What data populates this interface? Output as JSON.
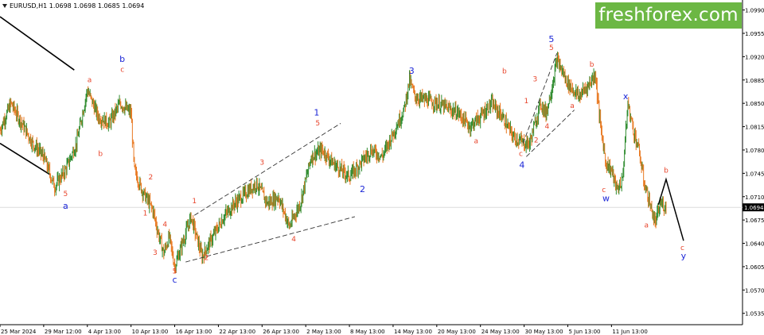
{
  "header": {
    "symbol_line": "EURUSD,H1  1.0698 1.0698 1.0685 1.0694"
  },
  "brand": {
    "text": "freshforex.com",
    "color": "#6cb744"
  },
  "chart_data": {
    "type": "candlestick",
    "title": "",
    "symbol": "EURUSD",
    "timeframe": "H1",
    "ohlc_header": {
      "open": 1.0698,
      "high": 1.0698,
      "low": 1.0685,
      "close": 1.0694
    },
    "current_price": 1.0694,
    "current_price_label": "1.0694",
    "ylim": [
      1.0518,
      1.1005
    ],
    "yticks": [
      1.099,
      1.0955,
      1.092,
      1.0885,
      1.085,
      1.0815,
      1.078,
      1.0745,
      1.071,
      1.0675,
      1.064,
      1.0605,
      1.057,
      1.0535
    ],
    "ytick_labels": [
      "1.0990",
      "1.0955",
      "1.0920",
      "1.0885",
      "1.0850",
      "1.0815",
      "1.0780",
      "1.0745",
      "1.0710",
      "1.0675",
      "1.0640",
      "1.0605",
      "1.0570",
      "1.0535"
    ],
    "xticks": [
      0,
      4,
      8,
      12,
      16,
      20,
      24,
      28,
      32,
      36,
      40,
      44,
      48,
      52,
      56
    ],
    "xtick_labels": [
      "25 Mar 2024",
      "29 Mar 12:00",
      "4 Apr 13:00",
      "10 Apr 13:00",
      "16 Apr 13:00",
      "22 Apr 13:00",
      "26 Apr 13:00",
      "2 May 13:00",
      "8 May 13:00",
      "14 May 13:00",
      "20 May 13:00",
      "24 May 13:00",
      "30 May 13:00",
      "5 Jun 13:00",
      "11 Jun 13:00"
    ],
    "xlim": [
      0,
      68
    ],
    "grid": false,
    "colors": {
      "bull": "#2e8b2e",
      "bear": "#e87820",
      "red_label": "#e8452c",
      "blue_label": "#1a25d6"
    },
    "price_path": [
      [
        0.0,
        1.081
      ],
      [
        1.0,
        1.085
      ],
      [
        2.0,
        1.082
      ],
      [
        3.0,
        1.079
      ],
      [
        4.0,
        1.077
      ],
      [
        5.0,
        1.0725
      ],
      [
        6.0,
        1.075
      ],
      [
        7.0,
        1.079
      ],
      [
        8.0,
        1.087
      ],
      [
        9.0,
        1.083
      ],
      [
        10.0,
        1.082
      ],
      [
        11.0,
        1.085
      ],
      [
        12.0,
        1.0835
      ],
      [
        12.3,
        1.075
      ],
      [
        13.0,
        1.072
      ],
      [
        14.0,
        1.069
      ],
      [
        14.5,
        1.0655
      ],
      [
        15.0,
        1.0625
      ],
      [
        15.5,
        1.065
      ],
      [
        16.0,
        1.0605
      ],
      [
        16.5,
        1.063
      ],
      [
        17.5,
        1.068
      ],
      [
        18.0,
        1.065
      ],
      [
        18.5,
        1.062
      ],
      [
        19.5,
        1.065
      ],
      [
        20.5,
        1.068
      ],
      [
        21.5,
        1.07
      ],
      [
        22.5,
        1.0715
      ],
      [
        23.5,
        1.073
      ],
      [
        24.5,
        1.07
      ],
      [
        25.5,
        1.071
      ],
      [
        26.5,
        1.0665
      ],
      [
        27.5,
        1.07
      ],
      [
        28.5,
        1.077
      ],
      [
        29.5,
        1.078
      ],
      [
        30.5,
        1.076
      ],
      [
        32.0,
        1.074
      ],
      [
        33.0,
        1.076
      ],
      [
        34.0,
        1.078
      ],
      [
        35.0,
        1.077
      ],
      [
        36.0,
        1.0805
      ],
      [
        37.0,
        1.084
      ],
      [
        37.5,
        1.0885
      ],
      [
        38.0,
        1.086
      ],
      [
        40.0,
        1.085
      ],
      [
        42.0,
        1.0835
      ],
      [
        43.0,
        1.0815
      ],
      [
        44.0,
        1.083
      ],
      [
        45.0,
        1.085
      ],
      [
        46.0,
        1.083
      ],
      [
        47.0,
        1.08
      ],
      [
        48.0,
        1.079
      ],
      [
        48.5,
        1.079
      ],
      [
        49.0,
        1.082
      ],
      [
        49.5,
        1.085
      ],
      [
        50.0,
        1.0835
      ],
      [
        50.5,
        1.087
      ],
      [
        51.0,
        1.0915
      ],
      [
        52.0,
        1.088
      ],
      [
        53.0,
        1.086
      ],
      [
        54.0,
        1.088
      ],
      [
        54.5,
        1.0895
      ],
      [
        54.6,
        1.088
      ],
      [
        55.0,
        1.0815
      ],
      [
        55.5,
        1.076
      ],
      [
        56.0,
        1.075
      ],
      [
        56.5,
        1.072
      ],
      [
        57.0,
        1.0735
      ],
      [
        57.5,
        1.085
      ],
      [
        58.0,
        1.081
      ],
      [
        58.5,
        1.078
      ],
      [
        59.0,
        1.073
      ],
      [
        59.5,
        1.07
      ],
      [
        60.0,
        1.067
      ],
      [
        60.5,
        1.07
      ],
      [
        61.0,
        1.0694
      ]
    ],
    "wave_labels_red": [
      {
        "t": "5",
        "x": 6.0,
        "y": 1.0711
      },
      {
        "t": "a",
        "x": 8.2,
        "y": 1.0882
      },
      {
        "t": "b",
        "x": 9.2,
        "y": 1.0771
      },
      {
        "t": "c",
        "x": 11.2,
        "y": 1.0897
      },
      {
        "t": "2",
        "x": 13.8,
        "y": 1.0736
      },
      {
        "t": "1",
        "x": 13.3,
        "y": 1.0682
      },
      {
        "t": "4",
        "x": 15.1,
        "y": 1.0665
      },
      {
        "t": "3",
        "x": 14.2,
        "y": 1.0623
      },
      {
        "t": "5",
        "x": 16.0,
        "y": 1.0595
      },
      {
        "t": "1",
        "x": 17.8,
        "y": 1.07
      },
      {
        "t": "2",
        "x": 18.9,
        "y": 1.0615
      },
      {
        "t": "3",
        "x": 24.0,
        "y": 1.0758
      },
      {
        "t": "4",
        "x": 26.9,
        "y": 1.0643
      },
      {
        "t": "5",
        "x": 29.1,
        "y": 1.0817
      },
      {
        "t": "b",
        "x": 46.2,
        "y": 1.0895
      },
      {
        "t": "a",
        "x": 43.6,
        "y": 1.079
      },
      {
        "t": "1",
        "x": 48.2,
        "y": 1.085
      },
      {
        "t": "3",
        "x": 49.0,
        "y": 1.0883
      },
      {
        "t": "5",
        "x": 50.5,
        "y": 1.093
      },
      {
        "t": "c",
        "x": 47.7,
        "y": 1.0771
      },
      {
        "t": "2",
        "x": 49.1,
        "y": 1.0791
      },
      {
        "t": "4",
        "x": 50.1,
        "y": 1.0812
      },
      {
        "t": "b",
        "x": 54.2,
        "y": 1.0905
      },
      {
        "t": "a",
        "x": 52.4,
        "y": 1.0843
      },
      {
        "t": "c",
        "x": 55.3,
        "y": 1.0717
      },
      {
        "t": "b",
        "x": 61.0,
        "y": 1.0746
      },
      {
        "t": "a",
        "x": 59.2,
        "y": 1.0664
      },
      {
        "t": "c",
        "x": 62.5,
        "y": 1.063
      }
    ],
    "wave_labels_blue": [
      {
        "t": "a",
        "x": 6.0,
        "y": 1.0692
      },
      {
        "t": "b",
        "x": 11.2,
        "y": 1.0912
      },
      {
        "t": "c",
        "x": 16.0,
        "y": 1.0581
      },
      {
        "t": "1",
        "x": 29.0,
        "y": 1.0832
      },
      {
        "t": "2",
        "x": 33.2,
        "y": 1.0717
      },
      {
        "t": "3",
        "x": 37.7,
        "y": 1.0894
      },
      {
        "t": "4",
        "x": 47.8,
        "y": 1.0753
      },
      {
        "t": "5",
        "x": 50.5,
        "y": 1.0942
      },
      {
        "t": "x",
        "x": 57.3,
        "y": 1.0856
      },
      {
        "t": "w",
        "x": 55.5,
        "y": 1.0703
      },
      {
        "t": "y",
        "x": 62.6,
        "y": 1.0617
      }
    ],
    "dashed_channels": [
      [
        [
          17.0,
          1.0612
        ],
        [
          32.5,
          1.068
        ]
      ],
      [
        [
          17.8,
          1.0682
        ],
        [
          31.2,
          1.082
        ]
      ],
      [
        [
          47.9,
          1.079
        ],
        [
          51.0,
          1.0925
        ]
      ],
      [
        [
          48.2,
          1.077
        ],
        [
          52.6,
          1.084
        ]
      ]
    ],
    "solid_lines": [
      [
        [
          0.0,
          1.098
        ],
        [
          6.8,
          1.09
        ]
      ],
      [
        [
          0.0,
          1.079
        ],
        [
          4.6,
          1.0743
        ]
      ]
    ],
    "forecast_path": [
      [
        60.3,
        1.0698
      ],
      [
        61.0,
        1.0736
      ],
      [
        62.6,
        1.0644
      ]
    ]
  }
}
